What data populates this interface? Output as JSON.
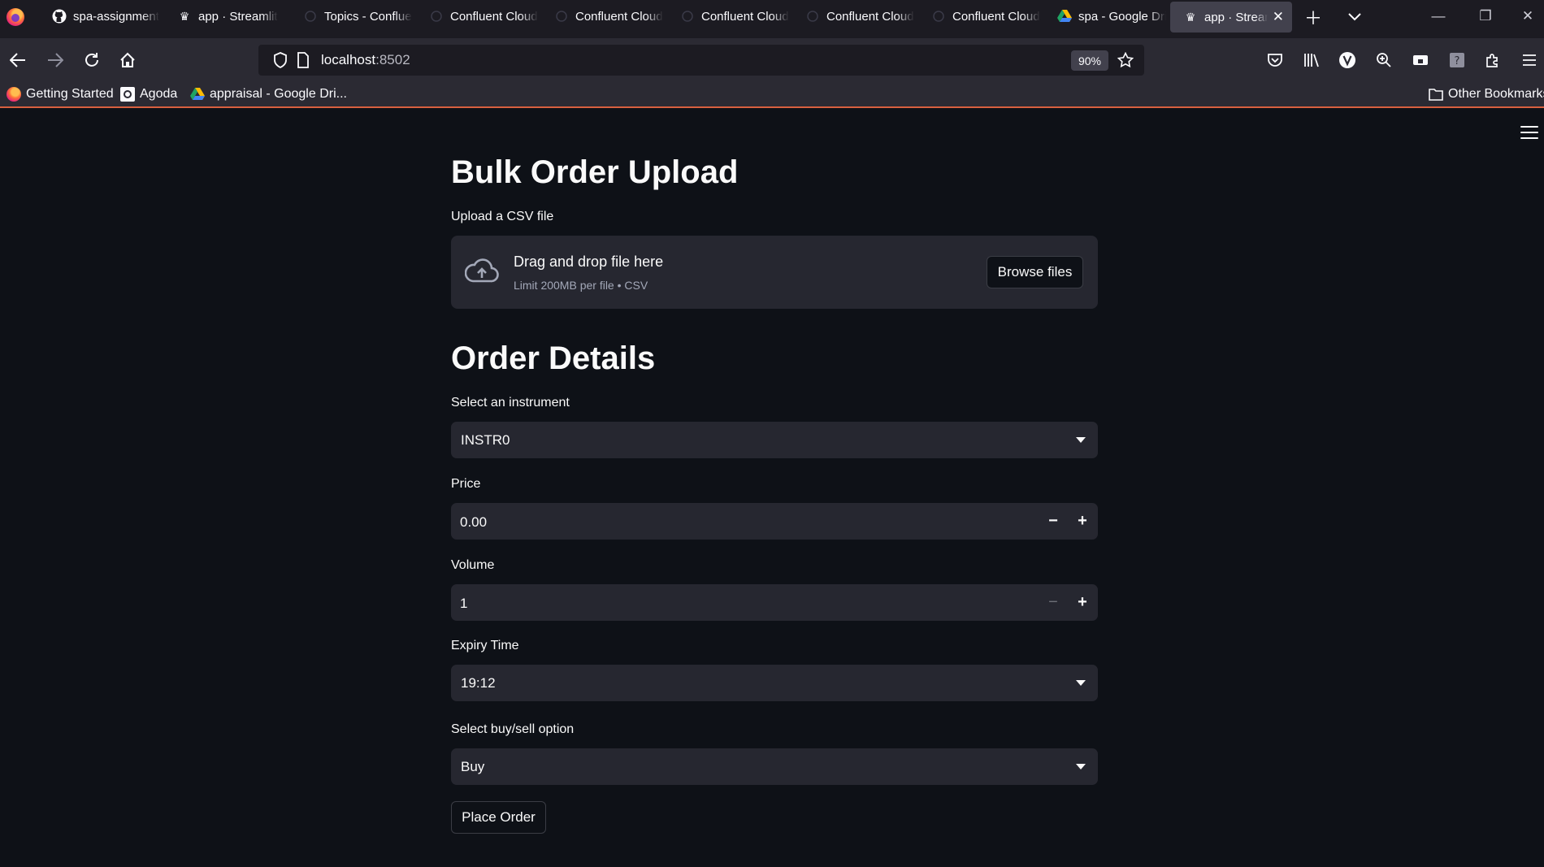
{
  "browser": {
    "tabs": [
      {
        "title": "spa-assignment",
        "icon": "github-icon"
      },
      {
        "title": "app · Streamlit",
        "icon": "streamlit-icon"
      },
      {
        "title": "Topics - Confluent",
        "icon": "confluent-icon"
      },
      {
        "title": "Confluent Cloud",
        "icon": "confluent-icon"
      },
      {
        "title": "Confluent Cloud",
        "icon": "confluent-icon"
      },
      {
        "title": "Confluent Cloud",
        "icon": "confluent-icon"
      },
      {
        "title": "Confluent Cloud",
        "icon": "confluent-icon"
      },
      {
        "title": "Confluent Cloud",
        "icon": "confluent-icon"
      },
      {
        "title": "spa - Google Drive",
        "icon": "google-drive-icon"
      },
      {
        "title": "app · Streamlit",
        "icon": "streamlit-icon",
        "active": true
      }
    ],
    "url_host": "localhost",
    "url_port": ":8502",
    "zoom": "90%",
    "bookmarks": [
      {
        "label": "Getting Started",
        "icon": "firefox-icon"
      },
      {
        "label": "Agoda",
        "icon": "agoda-icon"
      },
      {
        "label": "appraisal - Google Dri...",
        "icon": "google-drive-icon"
      }
    ],
    "other_bookmarks": "Other Bookmarks"
  },
  "app": {
    "title": "Bulk Order Upload",
    "uploader": {
      "label": "Upload a CSV file",
      "main_text": "Drag and drop file here",
      "sub_text": "Limit 200MB per file • CSV",
      "button": "Browse files"
    },
    "order_details": {
      "heading": "Order Details",
      "instrument_label": "Select an instrument",
      "instrument_value": "INSTR0",
      "price_label": "Price",
      "price_value": "0.00",
      "volume_label": "Volume",
      "volume_value": "1",
      "expiry_label": "Expiry Time",
      "expiry_value": "19:12",
      "side_label": "Select buy/sell option",
      "side_value": "Buy",
      "submit": "Place Order"
    }
  },
  "colors": {
    "background": "#0e1117",
    "widget": "#262730",
    "text": "#fafafa",
    "muted": "#a3a8b8",
    "accent_line": "#d8603f"
  }
}
